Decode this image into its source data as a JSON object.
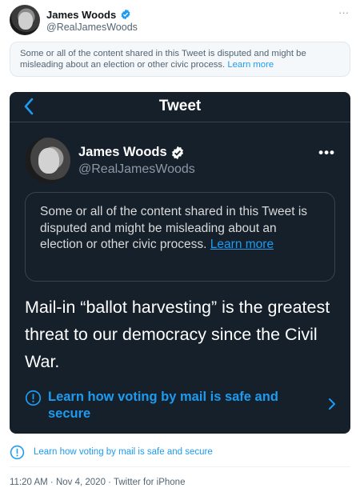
{
  "author": {
    "name": "James Woods",
    "handle": "@RealJamesWoods",
    "verified_icon": "verified-badge-icon"
  },
  "more_label": "···",
  "notice_light": {
    "text": "Some or all of the content shared in this Tweet is disputed and might be misleading about an election or other civic process.",
    "link": "Learn more"
  },
  "screenshot": {
    "title": "Tweet",
    "author_name": "James Woods",
    "author_handle": "@RealJamesWoods",
    "more_label": "•••",
    "notice_text": "Some or all of the content shared in this Tweet is disputed and might be misleading about an election or other civic process.",
    "notice_link": "Learn more",
    "tweet_text": "Mail-in “ballot harvesting” is the greatest threat to our democracy since the Civil War.",
    "voting_link": "Learn how voting by mail is safe and secure"
  },
  "voting_link": "Learn how voting by mail is safe and secure",
  "meta": "11:20 AM · Nov 4, 2020 · Twitter for iPhone",
  "colors": {
    "accent": "#1d9bf0",
    "dark_bg": "#15202b",
    "border_dark": "#38444d"
  }
}
